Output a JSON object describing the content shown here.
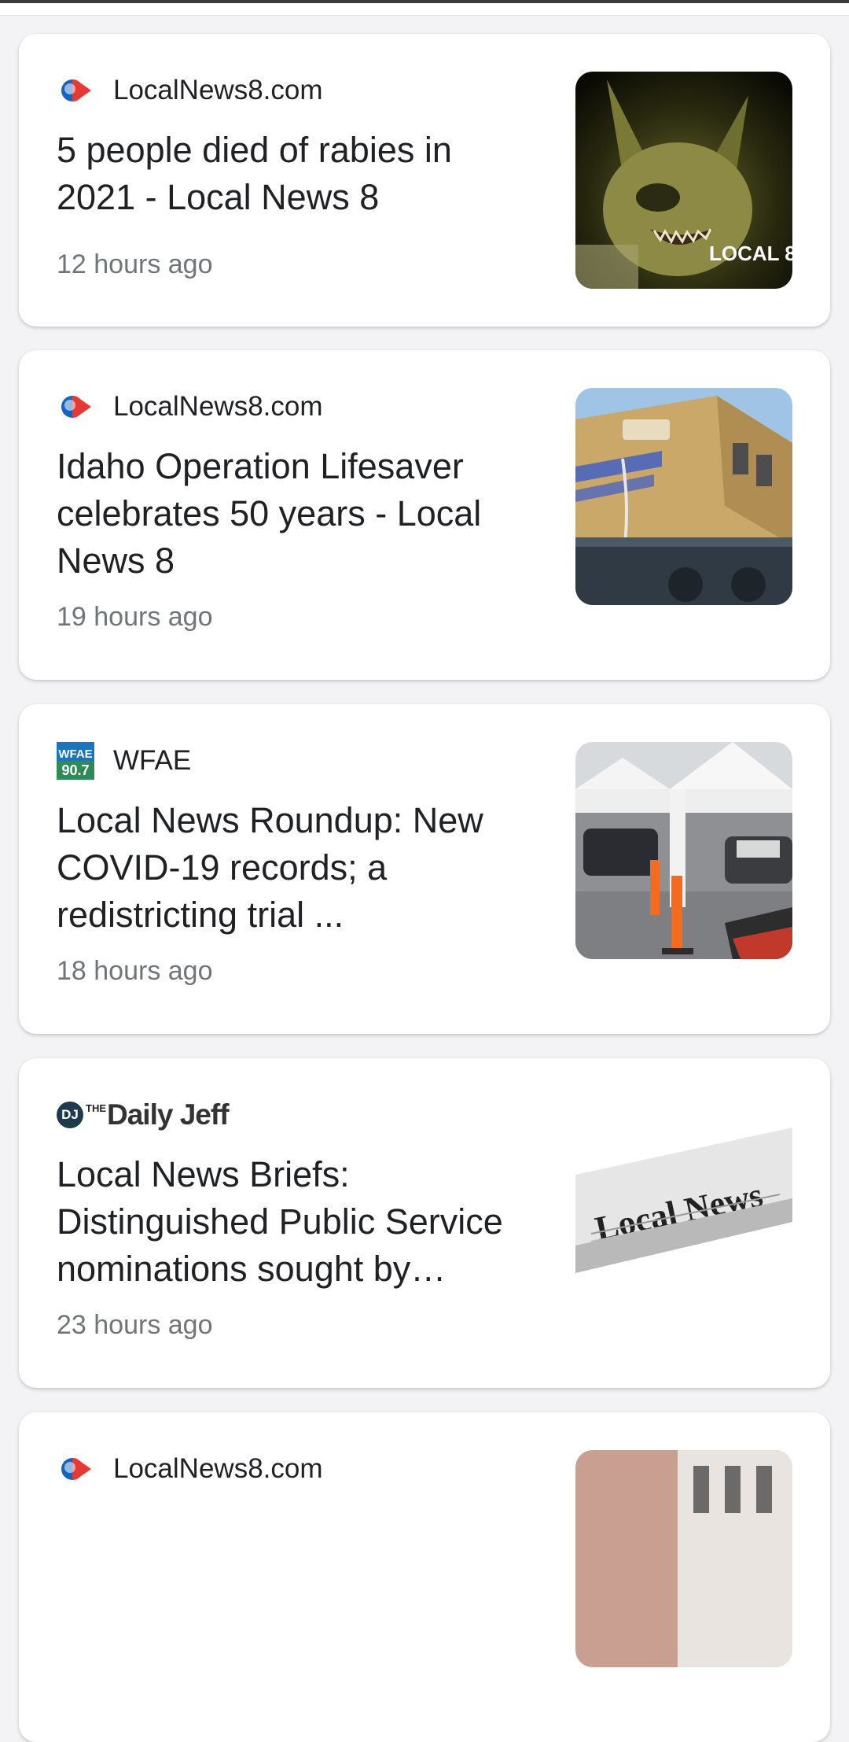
{
  "feed": {
    "articles": [
      {
        "source": "LocalNews8.com",
        "source_icon": "localnews8-icon",
        "headline": "5 people died of rabies in 2021 - Local News 8",
        "time": "12 hours ago",
        "thumbnail": "bat-photo",
        "thumbnail_text": "LOCAL 8"
      },
      {
        "source": "LocalNews8.com",
        "source_icon": "localnews8-icon",
        "headline": "Idaho Operation Lifesaver celebrates 50 years - Local News 8",
        "time": "19 hours ago",
        "thumbnail": "locomotive-photo"
      },
      {
        "source": "WFAE",
        "source_icon": "wfae-icon",
        "source_icon_text": "WFAE 90.7",
        "headline": "Local News Roundup: New COVID-19 records; a redistricting trial ...",
        "time": "18 hours ago",
        "thumbnail": "testing-site-photo"
      },
      {
        "source": "Daily Jeff",
        "source_logo_mark": "DJ",
        "source_logo_prefix": "THE",
        "source_icon": "daily-jeff-logo",
        "headline": "Local News Briefs: Distinguished Public Service nominations sought by…",
        "time": "23 hours ago",
        "thumbnail": "newspaper-photo",
        "thumbnail_text": "Local News"
      },
      {
        "source": "LocalNews8.com",
        "source_icon": "localnews8-icon",
        "thumbnail": "building-photo"
      }
    ]
  },
  "colors": {
    "background": "#f3f3f5",
    "card": "#ffffff",
    "headline": "#202124",
    "meta": "#70757a"
  }
}
